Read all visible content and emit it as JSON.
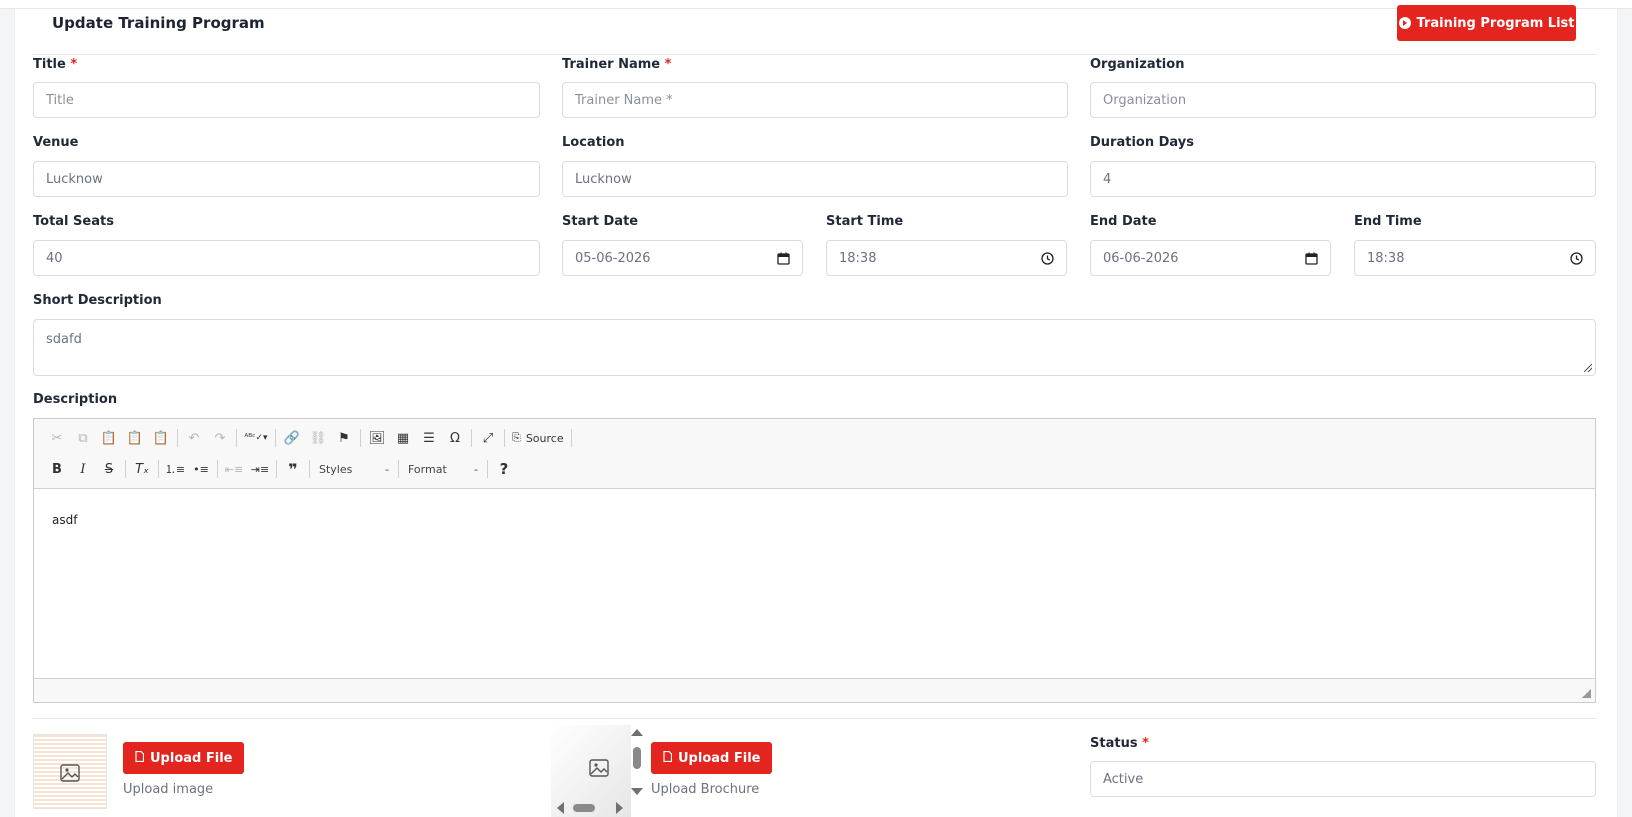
{
  "header": {
    "title": "Update Training Program",
    "list_button": "Training Program List"
  },
  "fields": {
    "title": {
      "label": "Title",
      "required": "*",
      "placeholder": "Title",
      "value": ""
    },
    "trainer_name": {
      "label": "Trainer Name",
      "required": "*",
      "placeholder": "Trainer Name *",
      "value": ""
    },
    "organization": {
      "label": "Organization",
      "placeholder": "Organization",
      "value": ""
    },
    "venue": {
      "label": "Venue",
      "value": "Lucknow"
    },
    "location": {
      "label": "Location",
      "value": "Lucknow"
    },
    "duration_days": {
      "label": "Duration Days",
      "value": "4"
    },
    "total_seats": {
      "label": "Total Seats",
      "value": "40"
    },
    "start_date": {
      "label": "Start Date",
      "value": "05-06-2026"
    },
    "start_time": {
      "label": "Start Time",
      "value": "18:38"
    },
    "end_date": {
      "label": "End Date",
      "value": "06-06-2026"
    },
    "end_time": {
      "label": "End Time",
      "value": "18:38"
    },
    "short_description": {
      "label": "Short Description",
      "value": "sdafd"
    },
    "description": {
      "label": "Description",
      "content": "asdf"
    },
    "status": {
      "label": "Status",
      "required": "*",
      "value": "Active"
    }
  },
  "editor": {
    "source_label": "Source",
    "styles_label": "Styles",
    "format_label": "Format",
    "help": "?",
    "combo_arrow": "-"
  },
  "uploads": {
    "image": {
      "button": "Upload File",
      "caption": "Upload image"
    },
    "brochure": {
      "button": "Upload File",
      "caption": "Upload Brochure"
    }
  },
  "colors": {
    "accent": "#e4251f",
    "required": "#e4251f",
    "border": "#d9dde3"
  }
}
